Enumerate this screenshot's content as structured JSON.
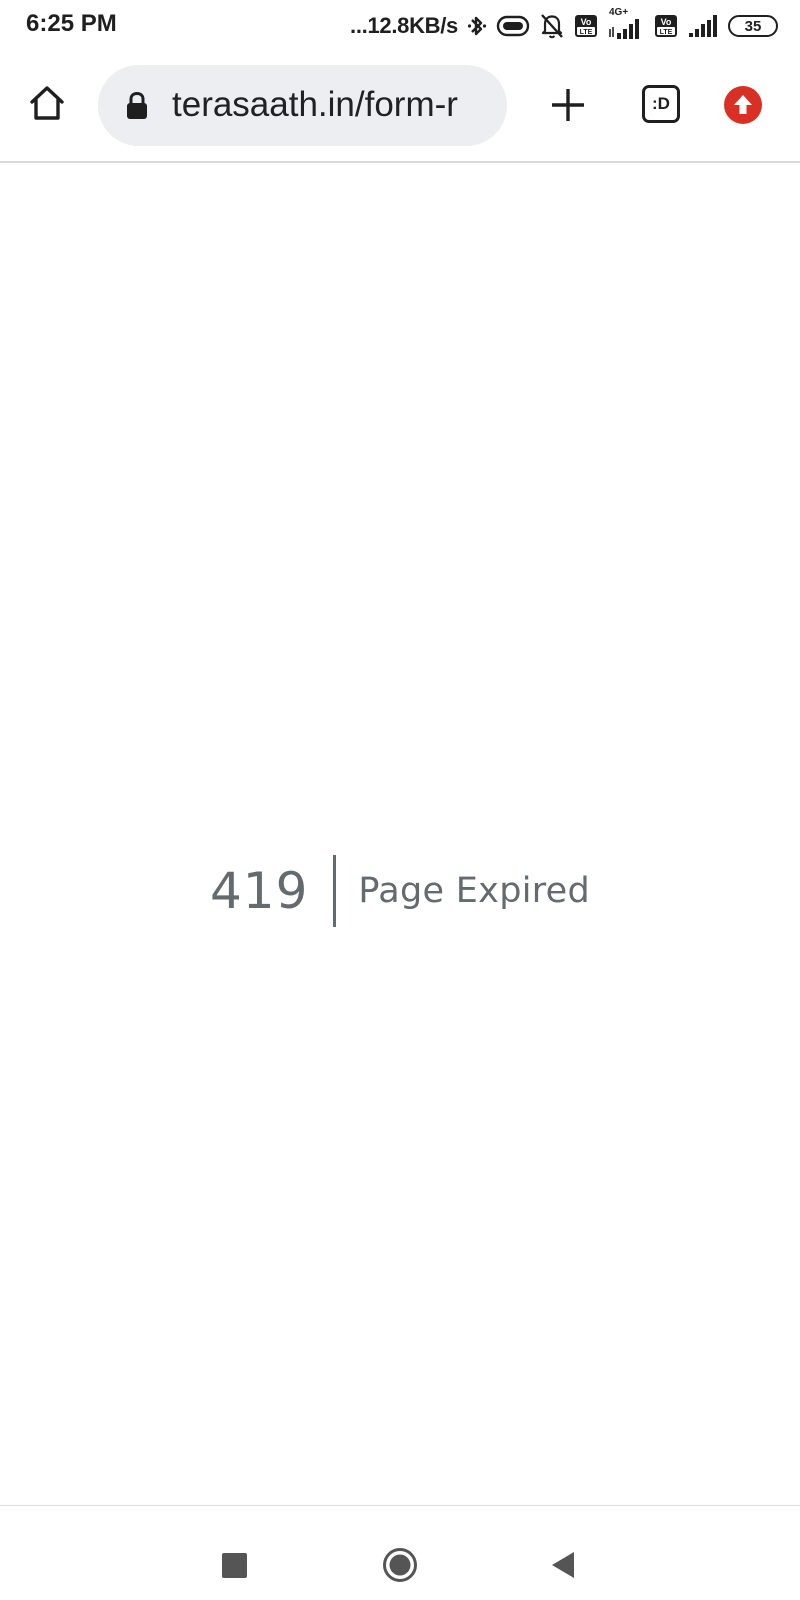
{
  "status_bar": {
    "time": "6:25 PM",
    "net_speed": "...12.8KB/s",
    "network_type": "4G+",
    "sim1_tag": "Vo LTE",
    "sim2_tag": "Vo LTE",
    "battery_level": "35",
    "icons": [
      "bluetooth-icon",
      "toggle-icon",
      "mute-bell-icon",
      "volte-icon",
      "signal-icon",
      "volte-icon",
      "signal-icon",
      "battery-icon"
    ]
  },
  "toolbar": {
    "url": "terasaath.in/form-r",
    "tabs_label": ":D",
    "icons": [
      "home-icon",
      "lock-icon",
      "plus-icon",
      "tabs-icon",
      "update-icon"
    ]
  },
  "page": {
    "error_code": "419",
    "error_message": "Page Expired"
  },
  "navigation": {
    "icons": [
      "recents-icon",
      "home-circle-icon",
      "back-icon"
    ]
  },
  "colors": {
    "error_text": "#636b6f",
    "url_bar_bg": "#eceef1",
    "update_badge": "#d93025"
  }
}
